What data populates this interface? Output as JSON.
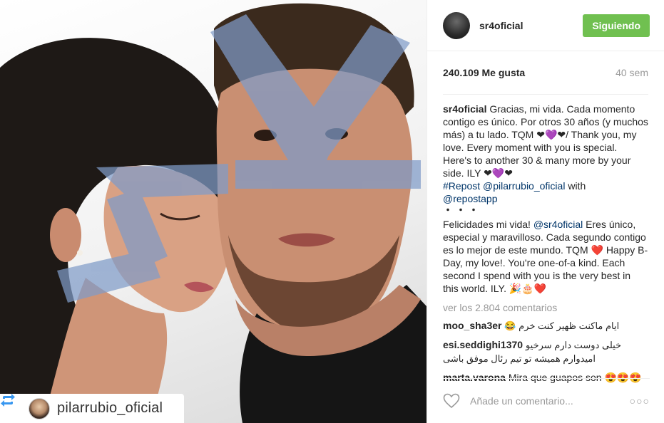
{
  "post": {
    "repost_badge_user": "pilarrubio_oficial"
  },
  "header": {
    "username": "sr4oficial",
    "follow_label": "Siguiendo"
  },
  "meta": {
    "likes": "240.109 Me gusta",
    "age": "40 sem"
  },
  "caption": {
    "username": "sr4oficial",
    "text": " Gracias, mi vida. Cada momento contigo es único. Por otros 30 años (y muchos más) a tu lado. TQM ❤💜❤/ Thank you, my love. Every moment with you is special. Here's to another 30 & many more by your side. ILY ❤💜❤",
    "hashtag": "#Repost",
    "mention": "@pilarrubio_oficial",
    "with_text": " with",
    "app_mention": "@repostapp",
    "dots": "・・・",
    "body_1": "Felicidades mi vida! ",
    "body_mention": "@sr4oficial",
    "body_2": " Eres único, especial y maravilloso. Cada segundo contigo es lo mejor de este mundo. TQM ❤️ Happy B-Day, my love!. You're one-of-a kind. Each second I spend with you is the very best in this world. ILY. 🎉🎂❤️"
  },
  "view_all": "ver los 2.804 comentarios",
  "comments": [
    {
      "user": "moo_sha3er",
      "text": "ايام ماكنت ظهير كنت خرم 😂",
      "rtl": true
    },
    {
      "user": "esi.seddighi1370",
      "text": "خیلی دوست دارم سرخیو امیدوارم همیشه تو تیم رئال موفق باشی",
      "rtl": true
    },
    {
      "user": "marta.varona",
      "text": "Mira que guapos son 😍😍😍",
      "rtl": false
    }
  ],
  "add_comment": {
    "placeholder": "Añade un comentario...",
    "more": "○○○"
  },
  "colors": {
    "follow_button": "#70c050",
    "link": "#003569",
    "muted": "#999999"
  }
}
